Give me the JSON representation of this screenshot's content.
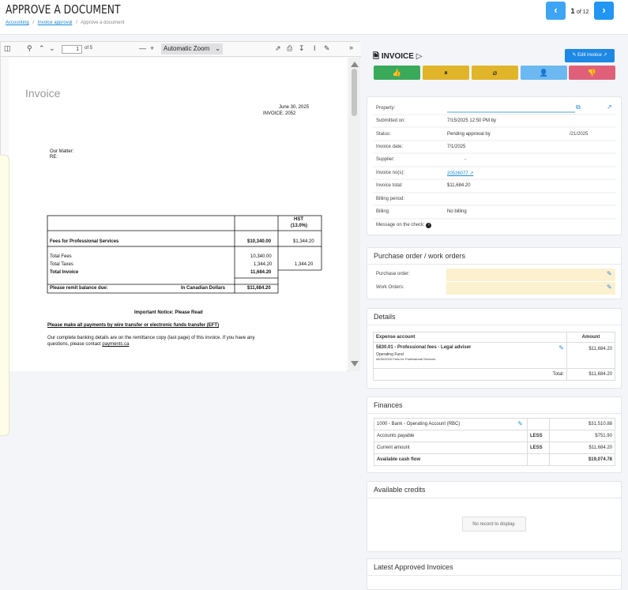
{
  "header": {
    "title": "APPROVE A DOCUMENT",
    "breadcrumbs": [
      "Accounting",
      "Invoice approval",
      "Approve a document"
    ],
    "breadcrumb_sep": "/",
    "pager_current": "1",
    "pager_of": "of 12",
    "prev_icon": "chevron-left-icon",
    "next_icon": "chevron-right-icon"
  },
  "viewer": {
    "page_value": "1",
    "page_of": "of 5",
    "zoom_label": "Automatic Zoom",
    "zoom_minus": "—",
    "zoom_plus": "+",
    "more": "»"
  },
  "pdf": {
    "heading": "Invoice",
    "date": "June 30, 2025",
    "invoice_no": "INVOICE: 2052",
    "our_matter": "Our Matter:",
    "re": "RE:",
    "hst_header": "HST",
    "hst_rate": "(13.0%)",
    "row_fees_label": "Fees for Professional Services",
    "row_fees_amount": "$10,340.00",
    "row_fees_hst": "$1,344.20",
    "total_fees_label": "Total Fees",
    "total_fees_amount": "10,340.00",
    "total_taxes_label": "Total Taxes",
    "total_taxes_amount": "1,344.20",
    "total_taxes_hst": "1,344.20",
    "total_invoice_label": "Total Invoice",
    "total_invoice_amount": "11,684.20",
    "remit_label": "Please remit balance due:",
    "remit_currency": "In Canadian Dollars",
    "remit_amount": "$11,684.20",
    "notice_title": "Important Notice: Please Read",
    "notice_line": "Please make all payments by wire transfer or electronic funds transfer (EFT)",
    "banking_line1": "Our complete banking details are on the remittance copy (last page) of this invoice. If you have any",
    "banking_line2": "questions, please contact",
    "banking_link": "payments.ca"
  },
  "invoice_panel": {
    "title": "INVOICE",
    "edit_label": "Edit invoice",
    "actions": [
      {
        "name": "approve-button",
        "icon": "👍",
        "color": "#3aa95a"
      },
      {
        "name": "pause-button",
        "icon": "⏸",
        "color": "#e0b52a"
      },
      {
        "name": "cancel-button",
        "icon": "⌀",
        "color": "#e0b52a"
      },
      {
        "name": "assign-user-button",
        "icon": "👤",
        "color": "#6cb8f0"
      },
      {
        "name": "reject-button",
        "icon": "👎",
        "color": "#e0607a"
      }
    ],
    "fields": [
      {
        "label": "Property:",
        "value": ""
      },
      {
        "label": "Submitted on:",
        "value": "7/15/2025 12:50 PM by"
      },
      {
        "label": "Status:",
        "value": "Pending approval by",
        "extra": "/21/2025"
      },
      {
        "label": "Invoice date:",
        "value": "7/1/2025"
      },
      {
        "label": "Supplier:",
        "value": "-"
      },
      {
        "label": "Invoice no(s):",
        "value": "20526077"
      },
      {
        "label": "Invoice total:",
        "value": "$11,684.20"
      },
      {
        "label": "Billing period:",
        "value": ""
      },
      {
        "label": "Billing:",
        "value": "No billing"
      },
      {
        "label": "Message on the check:",
        "value": ""
      }
    ]
  },
  "po": {
    "title": "Purchase order / work orders",
    "purchase_order_label": "Purchase order:",
    "work_orders_label": "Work Orders:"
  },
  "details": {
    "title": "Details",
    "col_account": "Expense account",
    "col_amount": "Amount",
    "account": "5830.01 - Professional fees - Legal adviser",
    "fund": "Operating Fund",
    "desc": "06/30/2025 Fees for Professional Services",
    "amount": "$11,684.20",
    "total_label": "Total:",
    "total_amount": "$11,684.20"
  },
  "finances": {
    "title": "Finances",
    "rows": [
      {
        "label": "1000 - Bank - Operating Account (RBC)",
        "mod": "",
        "amount": "$31,510.88"
      },
      {
        "label": "Accounts payable",
        "mod": "LESS",
        "amount": "$751.90"
      },
      {
        "label": "Current amount",
        "mod": "LESS",
        "amount": "$11,684.20"
      },
      {
        "label": "Available cash flow",
        "mod": "",
        "amount": "$19,074.78"
      }
    ]
  },
  "credits": {
    "title": "Available credits",
    "empty": "No record to display."
  },
  "latest": {
    "title": "Latest Approved Invoices"
  }
}
